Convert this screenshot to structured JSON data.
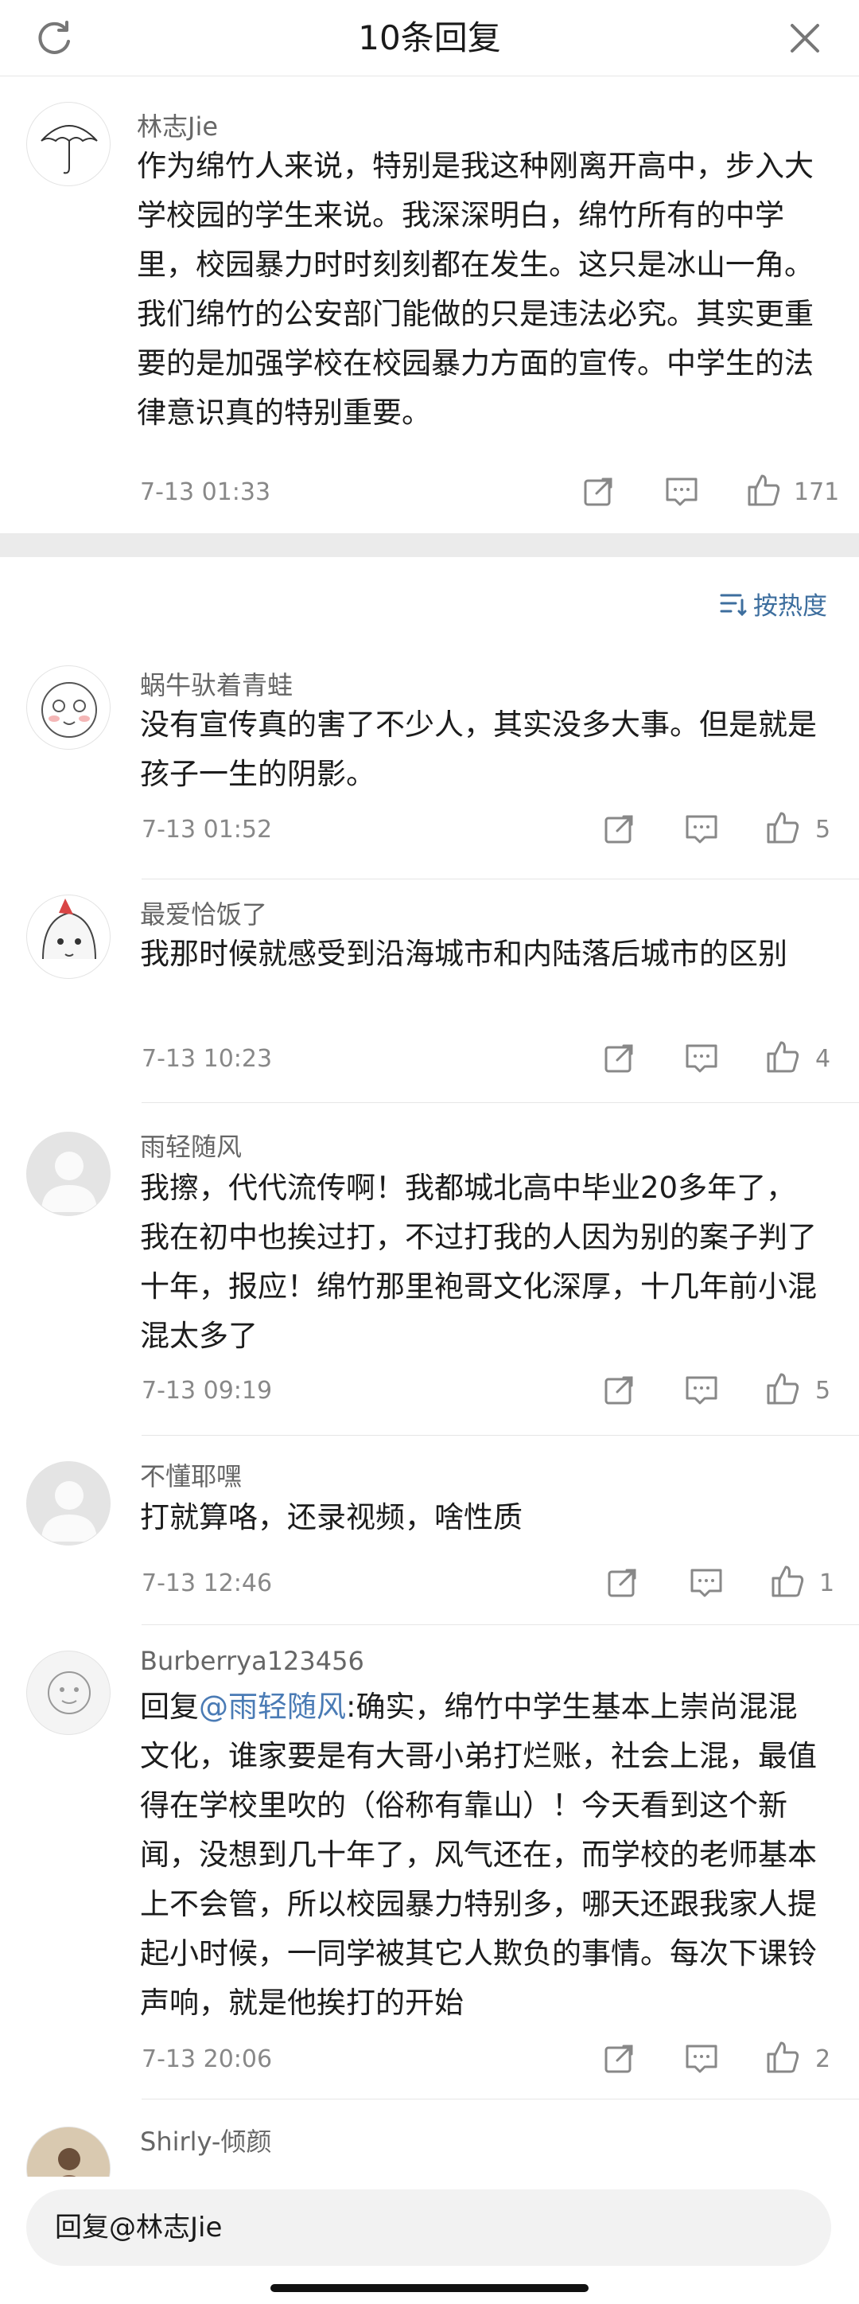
{
  "header": {
    "title": "10条回复",
    "refresh_icon": "refresh-icon",
    "close_icon": "close-icon"
  },
  "main_comment": {
    "user": "林志Jie",
    "text": "作为绵竹人来说，特别是我这种刚离开高中，步入大学校园的学生来说。我深深明白，绵竹所有的中学里，校园暴力时时刻刻都在发生。这只是冰山一角。我们绵竹的公安部门能做的只是违法必究。其实更重要的是加强学校在校园暴力方面的宣传。中学生的法律意识真的特别重要。",
    "time": "7-13 01:33",
    "likes": "171"
  },
  "sort": {
    "label": "按热度"
  },
  "replies": [
    {
      "user": "蜗牛驮着青蛙",
      "text": "没有宣传真的害了不少人，其实没多大事。但是就是孩子一生的阴影。",
      "time": "7-13 01:52",
      "likes": "5"
    },
    {
      "user": "最爱恰饭了",
      "text": "我那时候就感受到沿海城市和内陆落后城市的区别",
      "time": "7-13 10:23",
      "likes": "4"
    },
    {
      "user": "雨轻随风",
      "text": "我擦，代代流传啊！我都城北高中毕业20多年了，我在初中也挨过打，不过打我的人因为别的案子判了十年，报应！绵竹那里袍哥文化深厚，十几年前小混混太多了",
      "time": "7-13 09:19",
      "likes": "5"
    },
    {
      "user": "不懂耶嘿",
      "text": "打就算咯，还录视频，啥性质",
      "time": "7-13 12:46",
      "likes": "1"
    },
    {
      "user": "Burberrya123456",
      "reply_prefix": "回复",
      "mention": "@雨轻随风",
      "text": ":确实，绵竹中学生基本上崇尚混混文化，谁家要是有大哥小弟打烂账，社会上混，最值得在学校里吹的（俗称有靠山）！今天看到这个新闻，没想到几十年了，风气还在，而学校的老师基本上不会管，所以校园暴力特别多，哪天还跟我家人提起小时候，一同学被其它人欺负的事情。每次下课铃声响，就是他挨打的开始",
      "time": "7-13 20:06",
      "likes": "2"
    },
    {
      "user": "Shirly-倾颜"
    }
  ],
  "bottom": {
    "placeholder": "回复@林志Jie"
  },
  "colors": {
    "accent": "#4a7bb5",
    "sort": "#3d6e9e",
    "separator": "#ebebeb"
  }
}
